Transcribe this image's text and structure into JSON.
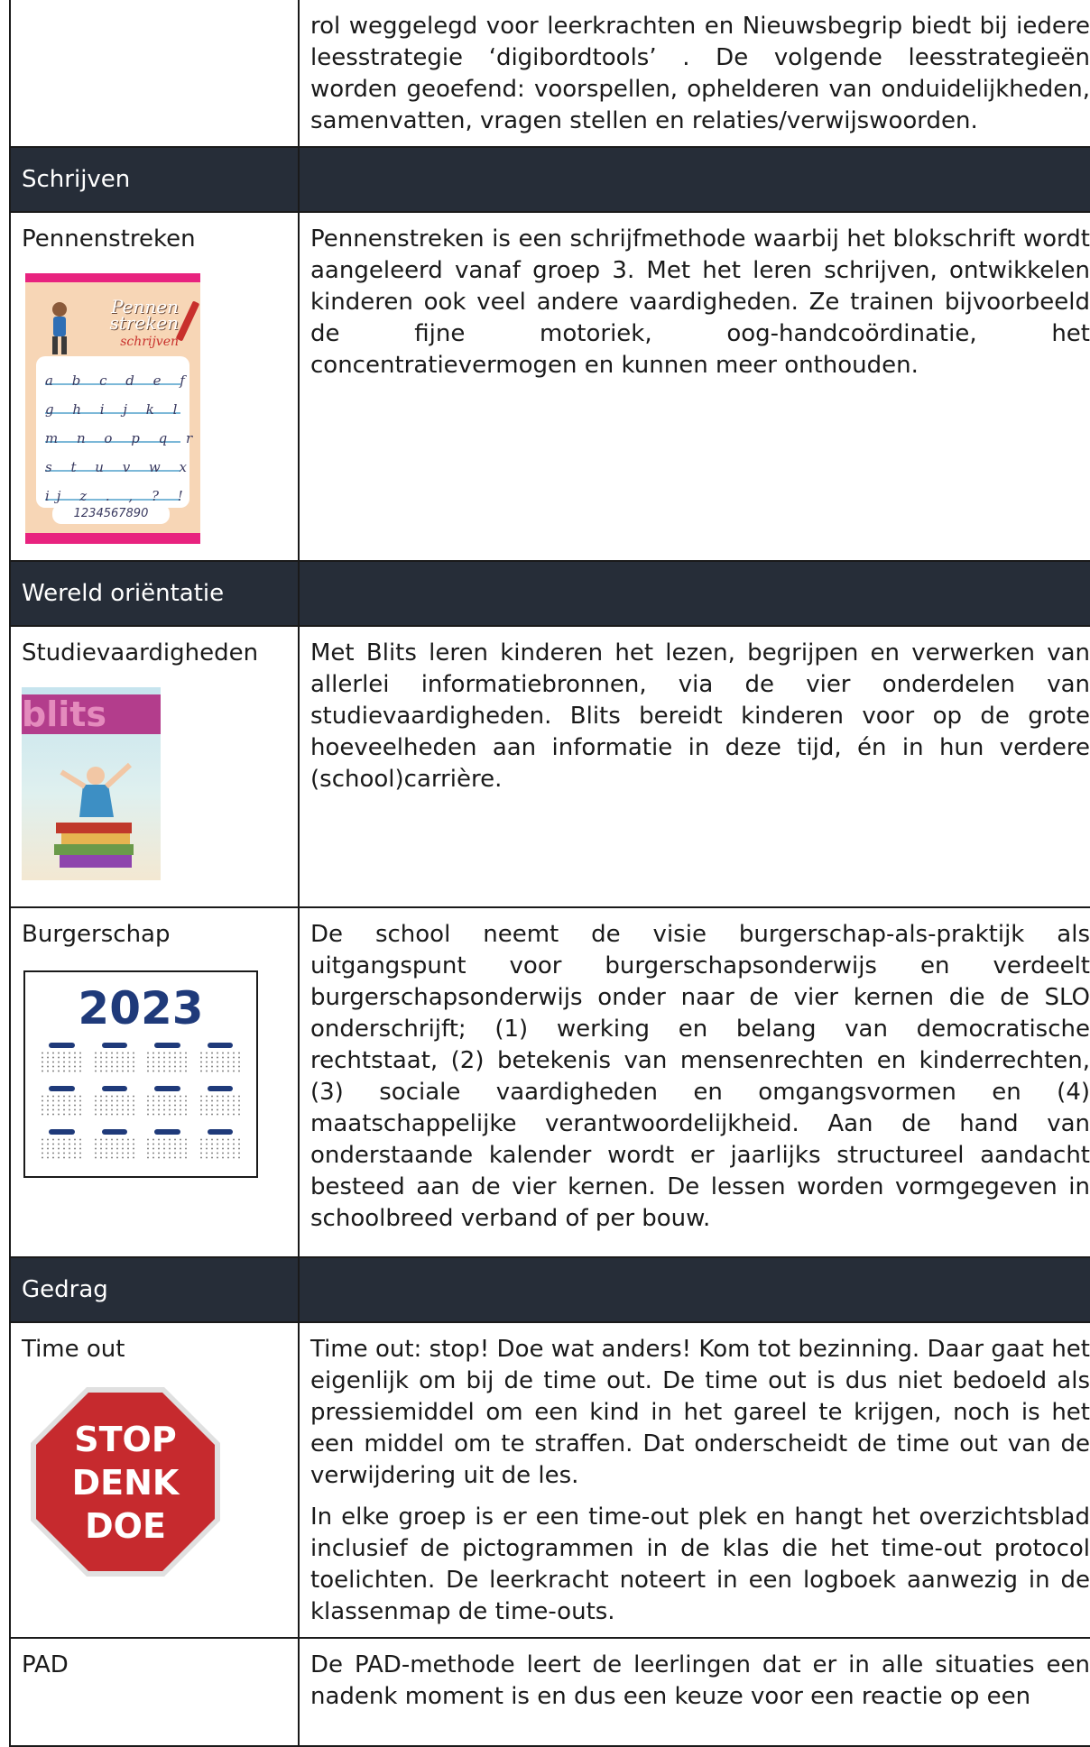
{
  "intro_text": "rol weggelegd voor leerkrachten en Nieuwsbegrip biedt bij iedere leesstrategie ‘digibordtools’ . De volgende leesstrategieën worden geoefend: voorspellen, ophelderen van onduidelijkheden, samenvatten, vragen stellen en relaties/verwijswoorden.",
  "sections": {
    "schrijven": "Schrijven",
    "wereld": "Wereld oriëntatie",
    "gedrag": "Gedrag"
  },
  "rows": {
    "pennenstreken": {
      "label": "Pennenstreken",
      "text": "Pennenstreken is een schrijfmethode waarbij het blokschrift wordt aangeleerd vanaf groep 3. Met het leren schrijven, ontwikkelen kinderen ook veel andere vaardigheden. Ze trainen bijvoorbeeld de fijne motoriek, oog-handcoördinatie, het concentratievermogen en kunnen meer onthouden.",
      "cover_title": "Pennen streken",
      "cover_subtitle": "schrijven",
      "cover_lines": [
        "a b c d e f",
        "g h i j k l",
        "m n o p q r",
        "s t u v w x",
        "ij z . , ? !"
      ],
      "cover_numbers": "1234567890"
    },
    "studievaardigheden": {
      "label": "Studievaardigheden",
      "text": "Met Blits leren kinderen het lezen, begrijpen en verwerken van allerlei informatiebronnen, via de vier onderdelen van studievaardigheden. Blits bereidt kinderen voor op de grote hoeveelheden aan informatie in deze tijd, én in hun verdere (school)carrière.",
      "cover_word": "blits"
    },
    "burgerschap": {
      "label": "Burgerschap",
      "text": "De school neemt de visie burgerschap-als-praktijk als uitgangspunt voor burgerschapsonderwijs en verdeelt burgerschapsonderwijs onder naar de vier kernen die de SLO onderschrijft; (1) werking en belang van democratische rechtstaat, (2) betekenis van mensenrechten en kinderrechten, (3) sociale vaardigheden en omgangsvormen en (4) maatschappelijke verantwoordelijkheid. Aan de hand van onderstaande kalender wordt er jaarlijks structureel aandacht besteed aan de vier kernen. De lessen worden vormgegeven in schoolbreed verband of per bouw.",
      "calendar_year": "2023"
    },
    "timeout": {
      "label": "Time out",
      "text_1": "Time out: stop! Doe wat anders! Kom tot bezinning. Daar gaat het eigenlijk om bij de time out. De time out is dus niet bedoeld als pressiemiddel om een kind in het gareel te krijgen, noch is het een middel om te straffen. Dat onderscheidt de time out van de verwijdering uit de les.",
      "text_2": "In elke groep is er een time-out plek en hangt het overzichtsblad inclusief de pictogrammen in de klas die het time-out protocol toelichten. De leerkracht noteert in een logboek aanwezig in de klassenmap de time-outs.",
      "sign_lines": [
        "STOP",
        "DENK",
        "DOE"
      ]
    },
    "pad": {
      "label": "PAD",
      "text": "De PAD-methode leert de leerlingen dat er in alle situaties een nadenk moment is en dus een keuze voor een reactie op een"
    }
  },
  "colors": {
    "section_bg": "#262d38",
    "section_text": "#ffffff",
    "border": "#1a1a1a",
    "stop_red": "#c62a2e",
    "calendar_blue": "#1f3a7a",
    "cover_pink": "#e8237f"
  }
}
